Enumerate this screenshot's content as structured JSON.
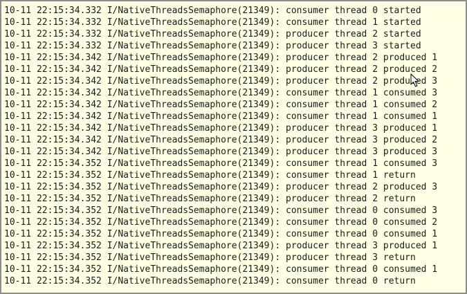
{
  "log": {
    "lines": [
      "10-11 22:15:34.332 I/NativeThreadsSemaphore(21349): consumer thread 0 started",
      "10-11 22:15:34.332 I/NativeThreadsSemaphore(21349): consumer thread 1 started",
      "10-11 22:15:34.332 I/NativeThreadsSemaphore(21349): producer thread 2 started",
      "10-11 22:15:34.332 I/NativeThreadsSemaphore(21349): producer thread 3 started",
      "10-11 22:15:34.342 I/NativeThreadsSemaphore(21349): producer thread 2 produced 1",
      "10-11 22:15:34.342 I/NativeThreadsSemaphore(21349): producer thread 2 produced 2",
      "10-11 22:15:34.342 I/NativeThreadsSemaphore(21349): producer thread 2 produced 3",
      "10-11 22:15:34.342 I/NativeThreadsSemaphore(21349): consumer thread 1 consumed 3",
      "10-11 22:15:34.342 I/NativeThreadsSemaphore(21349): consumer thread 1 consumed 2",
      "10-11 22:15:34.342 I/NativeThreadsSemaphore(21349): consumer thread 1 consumed 1",
      "10-11 22:15:34.342 I/NativeThreadsSemaphore(21349): producer thread 3 produced 1",
      "10-11 22:15:34.342 I/NativeThreadsSemaphore(21349): producer thread 3 produced 2",
      "10-11 22:15:34.342 I/NativeThreadsSemaphore(21349): producer thread 3 produced 3",
      "10-11 22:15:34.352 I/NativeThreadsSemaphore(21349): consumer thread 1 consumed 3",
      "10-11 22:15:34.352 I/NativeThreadsSemaphore(21349): consumer thread 1 return",
      "10-11 22:15:34.352 I/NativeThreadsSemaphore(21349): producer thread 2 produced 3",
      "10-11 22:15:34.352 I/NativeThreadsSemaphore(21349): producer thread 2 return",
      "10-11 22:15:34.352 I/NativeThreadsSemaphore(21349): consumer thread 0 consumed 3",
      "10-11 22:15:34.352 I/NativeThreadsSemaphore(21349): consumer thread 0 consumed 2",
      "10-11 22:15:34.352 I/NativeThreadsSemaphore(21349): consumer thread 0 consumed 1",
      "10-11 22:15:34.352 I/NativeThreadsSemaphore(21349): producer thread 3 produced 1",
      "10-11 22:15:34.352 I/NativeThreadsSemaphore(21349): producer thread 3 return",
      "10-11 22:15:34.352 I/NativeThreadsSemaphore(21349): consumer thread 0 consumed 1",
      "10-11 22:15:34.352 I/NativeThreadsSemaphore(21349): consumer thread 0 return"
    ]
  },
  "colors": {
    "background": "#ffffe5",
    "border": "#8c8c8c",
    "text": "#1a1a1a"
  },
  "icons": {
    "cursor": "mouse-pointer-icon"
  }
}
